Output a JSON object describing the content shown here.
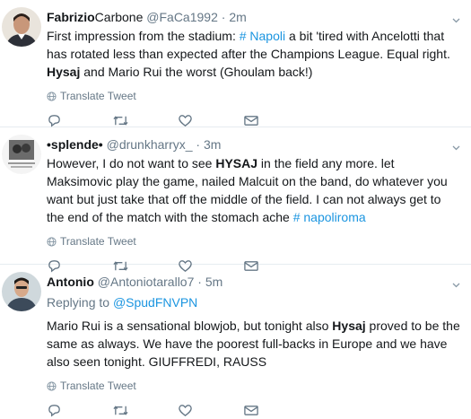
{
  "tweets": [
    {
      "fullname": "Fabrizio",
      "fullname2": "Carbone",
      "username": "@FaCa1992",
      "dot": "·",
      "time": "2m",
      "text": [
        {
          "t": "First impression from the stadium: ",
          "k": "plain"
        },
        {
          "t": "# Napoli",
          "k": "link"
        },
        {
          "t": " a bit 'tired with Ancelotti that has rotated less than expected after the Champions League. Equal right. ",
          "k": "plain"
        },
        {
          "t": "Hysaj",
          "k": "bold"
        },
        {
          "t": " and Mario Rui the worst (Ghoulam back!)",
          "k": "plain"
        }
      ],
      "translate": "Translate Tweet"
    },
    {
      "fullname": "•splende•",
      "username": "@drunkharryx_",
      "dot": "·",
      "time": "3m",
      "text": [
        {
          "t": "However, I do not want to see ",
          "k": "plain"
        },
        {
          "t": "HYSAJ",
          "k": "bold"
        },
        {
          "t": " in the field any more. let Maksimovic play the game, nailed Malcuit on the band, do whatever you want but just take that off the middle of the field. I can not always get to the end of the match with the stomach ache ",
          "k": "plain"
        },
        {
          "t": "# napoliroma",
          "k": "link"
        }
      ],
      "translate": "Translate Tweet"
    },
    {
      "fullname": "Antonio",
      "username": "@Antoniotarallo7",
      "dot": "·",
      "time": "5m",
      "replying_prefix": "Replying to ",
      "replying_to": "@SpudFNVPN",
      "text": [
        {
          "t": "Mario Rui is a sensational blowjob, but tonight also ",
          "k": "plain"
        },
        {
          "t": "Hysaj",
          "k": "bold"
        },
        {
          "t": " proved to be the same as always. We have the poorest full-backs in Europe and we have also seen tonight. GIUFFREDI, RAUSS",
          "k": "plain"
        }
      ],
      "translate": "Translate Tweet"
    }
  ],
  "icons": [
    "globe-icon",
    "reply-icon",
    "retweet-icon",
    "like-icon",
    "message-icon",
    "caret-down-icon"
  ],
  "colors": {
    "link": "#1b95e0",
    "muted": "#657786",
    "text": "#14171a",
    "divider": "#e6ecf0"
  }
}
